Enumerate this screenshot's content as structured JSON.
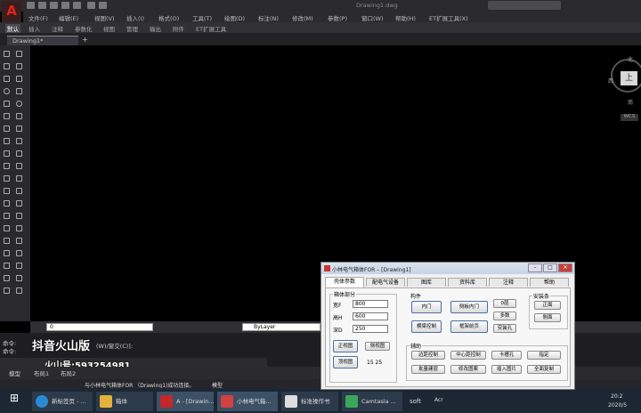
{
  "app": {
    "logo": "A",
    "document_title": "Drawing1.dwg"
  },
  "menus": [
    "文件(F)",
    "编辑(E)",
    "视图(V)",
    "插入(I)",
    "格式(O)",
    "工具(T)",
    "绘图(D)",
    "标注(N)",
    "修改(M)",
    "参数(P)",
    "窗口(W)",
    "帮助(H)",
    "ET扩展工具(X)"
  ],
  "ribbon_tabs": [
    "默认",
    "插入",
    "注释",
    "参数化",
    "视图",
    "管理",
    "输出",
    "附件",
    "ET扩展工具"
  ],
  "ribbon_active": "默认",
  "doc_tab": {
    "label": "Drawing1*",
    "plus": "+"
  },
  "viewcube": {
    "north": "北",
    "west": "西",
    "south": "南",
    "face": "上",
    "wcs": "WCS"
  },
  "properties": {
    "layer": "0",
    "linetype": "ByLayer"
  },
  "command_lines": [
    "命令:",
    "命令:"
  ],
  "command_partial": "(W)/窗交(C)]:",
  "watermark": {
    "app": "抖音火山版",
    "id": "火山号:593254981"
  },
  "layout_tabs": [
    "模型",
    "布局1",
    "布局2"
  ],
  "status_message": "与小林电气箱体FOR （Drawing1)成功连接。",
  "status_model": "模型",
  "dialog": {
    "title": "小林电气箱体FOR – [Drawing1]",
    "tabs": [
      "壳体参数",
      "配电气设备",
      "图库",
      "资料库",
      "注释",
      "帮助"
    ],
    "active_tab": "壳体参数",
    "group_box": "箱体部分",
    "fields": [
      {
        "label": "宽F",
        "value": "800"
      },
      {
        "label": "高H",
        "value": "600"
      },
      {
        "label": "深D",
        "value": "250"
      }
    ],
    "view_buttons": [
      "正视图",
      "侧视图",
      "顶视图"
    ],
    "dim_text": "15 25",
    "group_parts": "构件",
    "parts_buttons": [
      "内门",
      "侧板内门",
      "横梁控制",
      "框架前页"
    ],
    "parts_small": [
      "0层",
      "多数",
      "安装孔"
    ],
    "group_install": "安装条",
    "install_buttons": [
      "正面",
      "侧面"
    ],
    "group_aux": "辅助",
    "aux_buttons": [
      "边距控制",
      "中心距控制",
      "卡槽孔",
      "指定",
      "批量建层",
      "修改图案",
      "插入图片",
      "全面复制"
    ]
  },
  "taskbar": {
    "items": [
      "新标签页 - ...",
      "箱体",
      "A - [Drawin...",
      "小林电气箱...",
      "标准操作书",
      "Camtasia ..."
    ],
    "tray_soft": "soft",
    "tray_ime": "Acr",
    "time": "20:2",
    "date": "2020/5"
  }
}
